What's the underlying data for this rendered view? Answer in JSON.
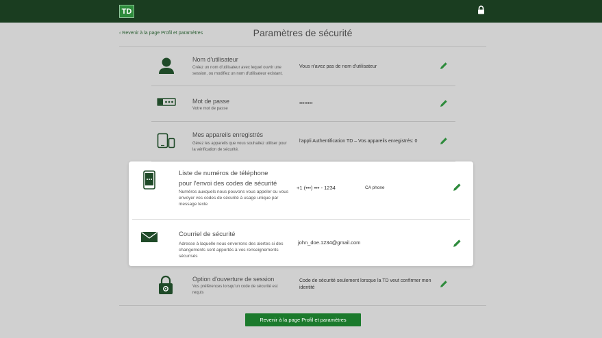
{
  "header": {
    "logo_text": "TD",
    "lock_icon": "lock-icon"
  },
  "nav": {
    "back_link": "‹ Revenir à la page Profil et paramètres"
  },
  "page": {
    "title": "Paramètres de sécurité"
  },
  "rows": [
    {
      "title": "Nom d'utilisateur",
      "desc": "Créez un nom d'utilisateur avec lequel ouvrir une session, ou modifiez un nom d'utilisateur existant.",
      "value": "Vous n'avez pas de nom d'utilisateur",
      "icon": "user-icon"
    },
    {
      "title": "Mot de passe",
      "desc": "Votre mot de passe",
      "value": "••••••••",
      "icon": "password-icon"
    },
    {
      "title": "Mes appareils enregistrés",
      "desc": "Gérez les appareils que vous souhaitez utiliser pour la vérification de sécurité.",
      "value": "l'appli Authentification TD – Vos appareils enregistrés: 0",
      "icon": "devices-icon"
    },
    {
      "title": "Option d'ouverture de session",
      "desc": "Vos préférences lorsqu'un code de sécurité est requis",
      "value": "Code de sécurité seulement lorsque la TD veut confirmer mon identité",
      "icon": "lock-gear-icon"
    }
  ],
  "card": {
    "phone": {
      "title_line1": "Liste de numéros de téléphone",
      "title_line2": "pour l'envoi des codes de sécurité",
      "desc": "Numéros auxquels nous pouvons vous appeler ou vous envoyer vos codes de sécurité à usage unique par message texte",
      "value": "+1 (•••) ••• - 1234",
      "country": "CA phone",
      "icon": "phone-icon"
    },
    "email": {
      "title": "Courriel de sécurité",
      "desc": "Adresse à laquelle nous enverrons des alertes si des changements sont apportés à vos renseignements sécurisés",
      "value": "john_doe.1234@gmail.com",
      "icon": "mail-icon"
    }
  },
  "footer": {
    "button_label": "Revenir à la page Profil et paramètres"
  },
  "colors": {
    "brand_dark": "#1a3d20",
    "brand_green": "#1b7a2c",
    "icon_green": "#2a6e36"
  }
}
